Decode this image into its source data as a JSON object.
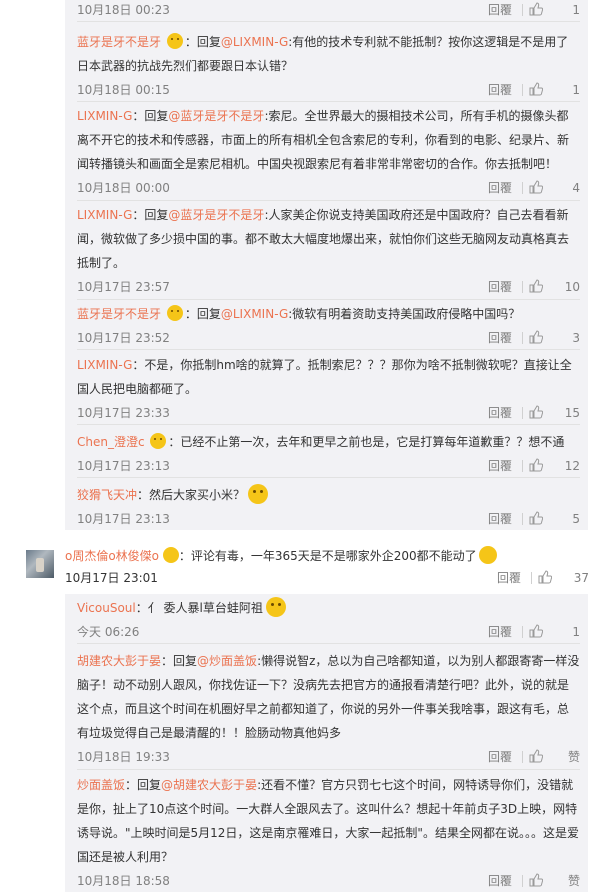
{
  "common": {
    "reply_label": "回覆",
    "reply_to": "回复",
    "like_icon": "thumbs-up-icon",
    "accent_color": "#eb7350"
  },
  "replies_top": [
    {
      "time": "10月18日 00:23",
      "likes": "1"
    },
    {
      "user": "蓝牙是牙不是牙",
      "emoji": "shy-emoji",
      "target": "@LIXMIN-G",
      "text": ":有他的技术专利就不能抵制？按你这逻辑是不是用了日本武器的抗战先烈们都要跟日本认错？",
      "time": "10月18日 00:15",
      "likes": "1"
    },
    {
      "user": "LIXMIN-G",
      "target": "@蓝牙是牙不是牙",
      "text": ":索尼。全世界最大的摄相技术公司，所有手机的摄像头都离不开它的技术和传感器，市面上的所有相机全包含索尼的专利，你看到的电影、纪录片、新闻转播镜头和画面全是索尼相机。中国央视跟索尼有着非常非常密切的合作。你去抵制吧！",
      "time": "10月18日 00:00",
      "likes": "4"
    },
    {
      "user": "LIXMIN-G",
      "target": "@蓝牙是牙不是牙",
      "text": ":人家美企你说支持美国政府还是中国政府？自己去看看新闻，微软做了多少损中国的事。都不敢太大幅度地爆出来，就怕你们这些无脑网友动真格真去抵制了。",
      "time": "10月17日 23:57",
      "likes": "10"
    },
    {
      "user": "蓝牙是牙不是牙",
      "emoji": "shy-emoji",
      "target": "@LIXMIN-G",
      "text": ":微软有明着资助支持美国政府侵略中国吗？",
      "time": "10月17日 23:52",
      "likes": "3"
    },
    {
      "user": "LIXMIN-G",
      "text": "：不是，你抵制hm啥的就算了。抵制索尼？？？那你为啥不抵制微软呢？直接让全国人民把电脑都砸了。",
      "time": "10月17日 23:33",
      "likes": "15"
    },
    {
      "user": "Chen_澄澄c",
      "emoji": "shy-emoji",
      "text": "：已经不止第一次，去年和更早之前也是，它是打算每年道歉重？？想不通",
      "time": "10月17日 23:13",
      "likes": "12"
    },
    {
      "user": "狡猾飞天冲",
      "text": "：然后大家买小米？",
      "big_emoji": "shocked-emoji",
      "time": "10月17日 23:13",
      "likes": "5"
    }
  ],
  "main_comment": {
    "user": "o周杰倫o林俊傑o",
    "emoji": "shy-emoji",
    "text": "：评论有毒，一年365天是不是哪家外企200都不能动了",
    "big_emoji": "smirk-emoji",
    "time": "10月17日 23:01",
    "likes": "37"
  },
  "replies_bottom": [
    {
      "user": "VicouSoul",
      "text": "：亻 委人暴l草台蛙阿祖",
      "big_emoji": "grin-emoji",
      "time": "今天 06:26",
      "likes": "1"
    },
    {
      "user": "胡建农大彭于晏",
      "target": "@炒面盖饭",
      "text": ":懒得说智z，总以为自己啥都知道，以为别人都跟寄寄一样没脑子！动不动别人跟风，你找佐证一下？没病先去把官方的通报看清楚行吧？此外，说的就是这个点，而且这个时间在机圈好早之前都知道了，你说的另外一件事关我啥事，跟这有毛，总有垃圾觉得自己是最清醒的！！脸肠动物真他妈多",
      "time": "10月18日 19:33",
      "likes": "赞"
    },
    {
      "user": "炒面盖饭",
      "target": "@胡建农大彭于晏",
      "text": ":还看不懂？官方只罚七七这个时间，网特诱导你们，没错就是你，扯上了10点这个时间。一大群人全跟风去了。这叫什么？想起十年前贞子3D上映，网特诱导说。\"上映时间是5月12日，这是南京罹难日，大家一起抵制\"。结果全网都在说。。。这是爱国还是被人利用？",
      "time": "10月18日 18:58",
      "likes": "赞"
    }
  ]
}
